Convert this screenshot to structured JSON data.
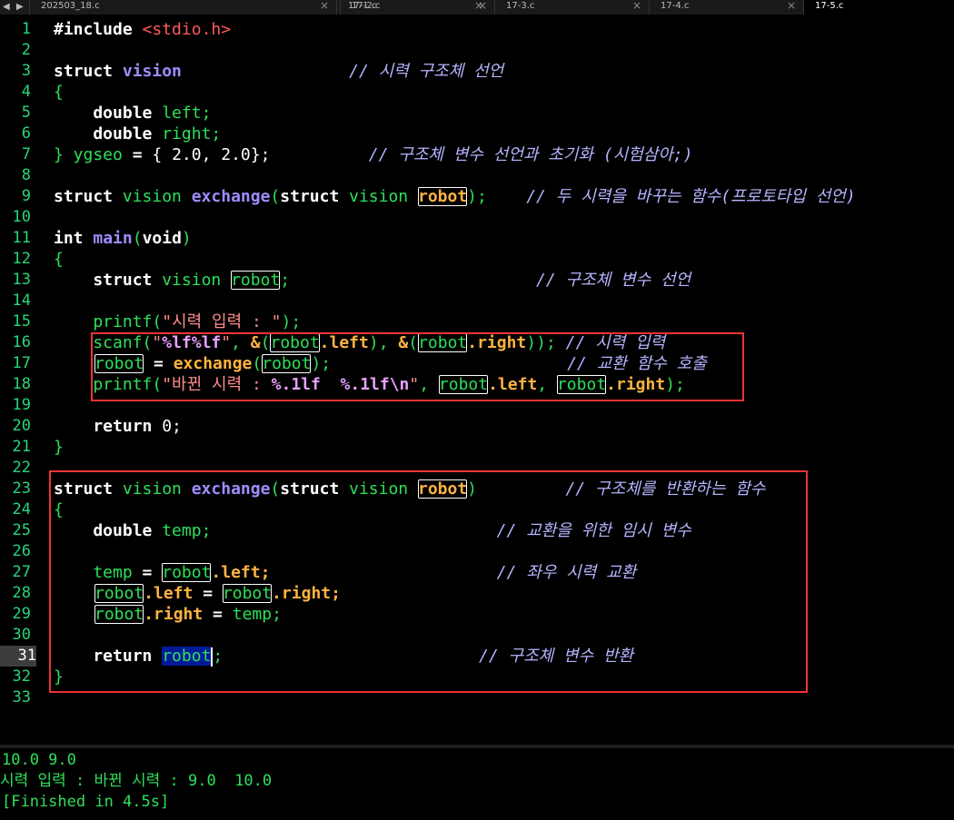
{
  "tabs": [
    {
      "name": "202503_18.c",
      "close": "×"
    },
    {
      "name": "17-1.c",
      "close": "×"
    },
    {
      "name": "17-2.c",
      "close": "×"
    },
    {
      "name": "17-3.c",
      "close": "×"
    },
    {
      "name": "17-4.c",
      "close": "×"
    },
    {
      "name": "17-5.c",
      "close": ""
    }
  ],
  "nav": "◀ ▶",
  "line_numbers": [
    "1",
    "2",
    "3",
    "4",
    "5",
    "6",
    "7",
    "8",
    "9",
    "10",
    "11",
    "12",
    "13",
    "14",
    "15",
    "16",
    "17",
    "18",
    "19",
    "20",
    "21",
    "22",
    "23",
    "24",
    "25",
    "26",
    "27",
    "28",
    "29",
    "30",
    "31",
    "32",
    "33"
  ],
  "current_line": "31",
  "code": {
    "l1a": "#include ",
    "l1b": "<stdio.h>",
    "l3a": "struct ",
    "l3b": "vision",
    "l3c": "                 // 시력 구조체 선언",
    "l4": "{",
    "l5a": "    double ",
    "l5b": "left;",
    "l6a": "    double ",
    "l6b": "right;",
    "l7a": "} ygseo ",
    "l7b": "= ",
    "l7c": "{ 2.0, 2.0};",
    "l7d": "          // 구조체 변수 선언과 초기화 (시험삼아;)",
    "l9a": "struct ",
    "l9b": "vision ",
    "l9c": "exchange",
    "l9d": "(",
    "l9e": "struct ",
    "l9f": "vision ",
    "l9g": "robot",
    "l9h": ");",
    "l9i": "    // 두 시력을 바꾸는 함수(프로토타입 선언)",
    "l11a": "int ",
    "l11b": "main",
    "l11c": "(",
    "l11d": "void",
    "l11e": ")",
    "l12": "{",
    "l13a": "    struct ",
    "l13b": "vision ",
    "l13c": "robot",
    "l13d": ";",
    "l13e": "                         // 구조체 변수 선언",
    "l15a": "    printf",
    "l15b": "(",
    "l15c": "\"시력 입력 : \"",
    "l15d": ");",
    "l16a": "    scanf",
    "l16b": "(",
    "l16c": "\"",
    "l16d": "%lf%lf",
    "l16e": "\"",
    "l16f": ", ",
    "l16g": "&",
    "l16h": "(",
    "l16i": "robot",
    "l16j": ".left",
    "l16k": "), ",
    "l16l": "&",
    "l16m": "(",
    "l16n": "robot",
    "l16o": ".right",
    "l16p": ")); ",
    "l16q": "// 시력 입력",
    "l17a": "robot",
    "l17b": " = ",
    "l17c": "exchange",
    "l17d": "(",
    "l17e": "robot",
    "l17f": ");",
    "l17g": "                        // 교환 함수 호출",
    "l18a": "    printf",
    "l18b": "(",
    "l18c": "\"바뀐 시력 : ",
    "l18d": "%.1lf  %.1lf\\n",
    "l18e": "\"",
    "l18f": ", ",
    "l18g": "robot",
    "l18h": ".left",
    "l18i": ", ",
    "l18j": "robot",
    "l18k": ".right",
    "l18l": ");",
    "l20a": "    return ",
    "l20b": "0;",
    "l21": "}",
    "l23a": "struct ",
    "l23b": "vision ",
    "l23c": "exchange",
    "l23d": "(",
    "l23e": "struct ",
    "l23f": "vision ",
    "l23g": "robot",
    "l23h": ")",
    "l23i": "         // 구조체를 반환하는 함수",
    "l24": "{",
    "l25a": "    double ",
    "l25b": "temp;",
    "l25c": "                             // 교환을 위한 임시 변수",
    "l27a": "    temp ",
    "l27b": "= ",
    "l27c": "robot",
    "l27d": ".left;",
    "l27e": "                       // 좌우 시력 교환",
    "l28a": "robot",
    "l28b": ".left ",
    "l28c": "= ",
    "l28d": "robot",
    "l28e": ".right;",
    "l29a": "robot",
    "l29b": ".right ",
    "l29c": "= ",
    "l29d": "temp;",
    "l31a": "    return ",
    "l31b": "robot",
    "l31c": ";",
    "l31d": "                          // 구조체 변수 반환",
    "l32": "}"
  },
  "output": [
    "10.0 9.0",
    "시력 입력 : 바뀐 시력 : 9.0  10.0",
    "[Finished in 4.5s]"
  ]
}
